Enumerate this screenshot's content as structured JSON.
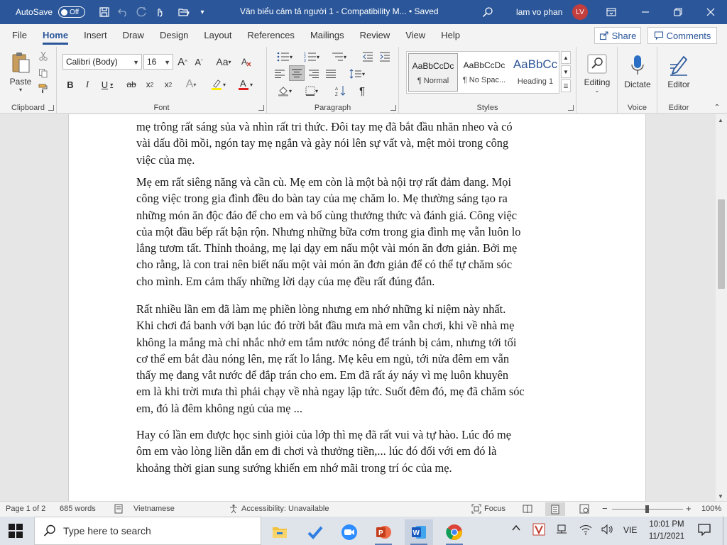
{
  "titlebar": {
    "autosave_label": "AutoSave",
    "autosave_state": "Off",
    "doc_title": "Văn biểu cảm tả người 1  -  Compatibility M...  •  Saved",
    "user_name": "lam vo phan",
    "user_initials": "LV"
  },
  "tabs": [
    "File",
    "Home",
    "Insert",
    "Draw",
    "Design",
    "Layout",
    "References",
    "Mailings",
    "Review",
    "View",
    "Help"
  ],
  "share_label": "Share",
  "comments_label": "Comments",
  "ribbon": {
    "clipboard": {
      "label": "Clipboard",
      "paste_label": "Paste"
    },
    "font": {
      "label": "Font",
      "font_name": "Calibri (Body)",
      "font_size": "16"
    },
    "paragraph": {
      "label": "Paragraph"
    },
    "styles": {
      "label": "Styles",
      "items": [
        {
          "sample": "AaBbCcDc",
          "name": "¶ Normal"
        },
        {
          "sample": "AaBbCcDc",
          "name": "¶ No Spac..."
        },
        {
          "sample": "AaBbCc",
          "name": "Heading 1"
        }
      ]
    },
    "editing": {
      "label": "Editing"
    },
    "voice": {
      "label": "Voice",
      "dictate_label": "Dictate"
    },
    "editor": {
      "label": "Editor",
      "editor_label": "Editor"
    }
  },
  "document": {
    "paragraphs": [
      [
        "mẹ trông rất sáng sủa và nhìn rất tri thức. Đôi tay mẹ đã bắt đầu nhăn nheo và có",
        "vài dấu đồi mồi, ngón tay mẹ ngắn và gày nói lên sự vất và, mệt mỏi trong công",
        "việc của mẹ."
      ],
      [
        "Mẹ em rất siêng năng và cần cù. Mẹ em còn là một bà nội trợ rất đảm đang. Mọi",
        "công việc trong gia đình đều do bàn tay của mẹ chăm lo. Mẹ thường sáng tạo ra",
        "những món ăn độc đáo để cho em và bố cùng thưởng thức và đánh giá. Công việc",
        "của một đầu bếp rất bận rộn. Nhưng những bữa cơm trong gia đình mẹ vẫn luôn lo",
        "lắng tươm tất. Thỉnh thoảng, mẹ lại dạy em nấu một vài món ăn đơn giản. Bởi mẹ",
        "cho rằng, là con trai nên biết nấu một vài món ăn đơn giản để có thể tự chăm sóc",
        "cho mình. Em cảm thấy những lời dạy của mẹ đều rất đúng đắn."
      ],
      [
        "Rất nhiều lần em đã làm mẹ phiền lòng nhưng em nhớ những kỉ niệm này nhất.",
        "Khi chơi đá banh với bạn lúc đó trời bắt đầu mưa mà em vẫn chơi, khi về nhà mẹ",
        "không la mắng mà chỉ nhắc nhở em tắm nước nóng để tránh bị cảm, nhưng tới tối",
        "cơ thể em bắt đàu nóng lên, mẹ rất lo lắng. Mẹ kêu em ngủ, tới nửa đêm em vẫn",
        "thấy mẹ đang vắt nước để đắp trán cho em. Em đã rất áy náy vì mẹ luôn khuyên",
        "em là khi trời mưa thì phải chạy về nhà ngay lập tức. Suốt đêm đó, mẹ đã chăm sóc",
        "em, đó là đêm không ngủ của mẹ ..."
      ],
      [
        "Hay có lần em được học sinh giỏi của lớp thì mẹ đã rất vui và tự hào. Lúc đó mẹ",
        "ôm em vào lòng liền dẫn em đi chơi và thưởng tiền,... lúc đó đối với em đó là",
        "khoảng thời gian sung sướng khiến em nhớ mãi trong trí óc của mẹ."
      ]
    ]
  },
  "statusbar": {
    "page": "Page 1 of 2",
    "words": "685 words",
    "language": "Vietnamese",
    "accessibility": "Accessibility: Unavailable",
    "focus": "Focus",
    "zoom": "100%"
  },
  "taskbar": {
    "search_placeholder": "Type here to search",
    "lang": "VIE",
    "time": "10:01 PM",
    "date": "11/1/2021"
  }
}
